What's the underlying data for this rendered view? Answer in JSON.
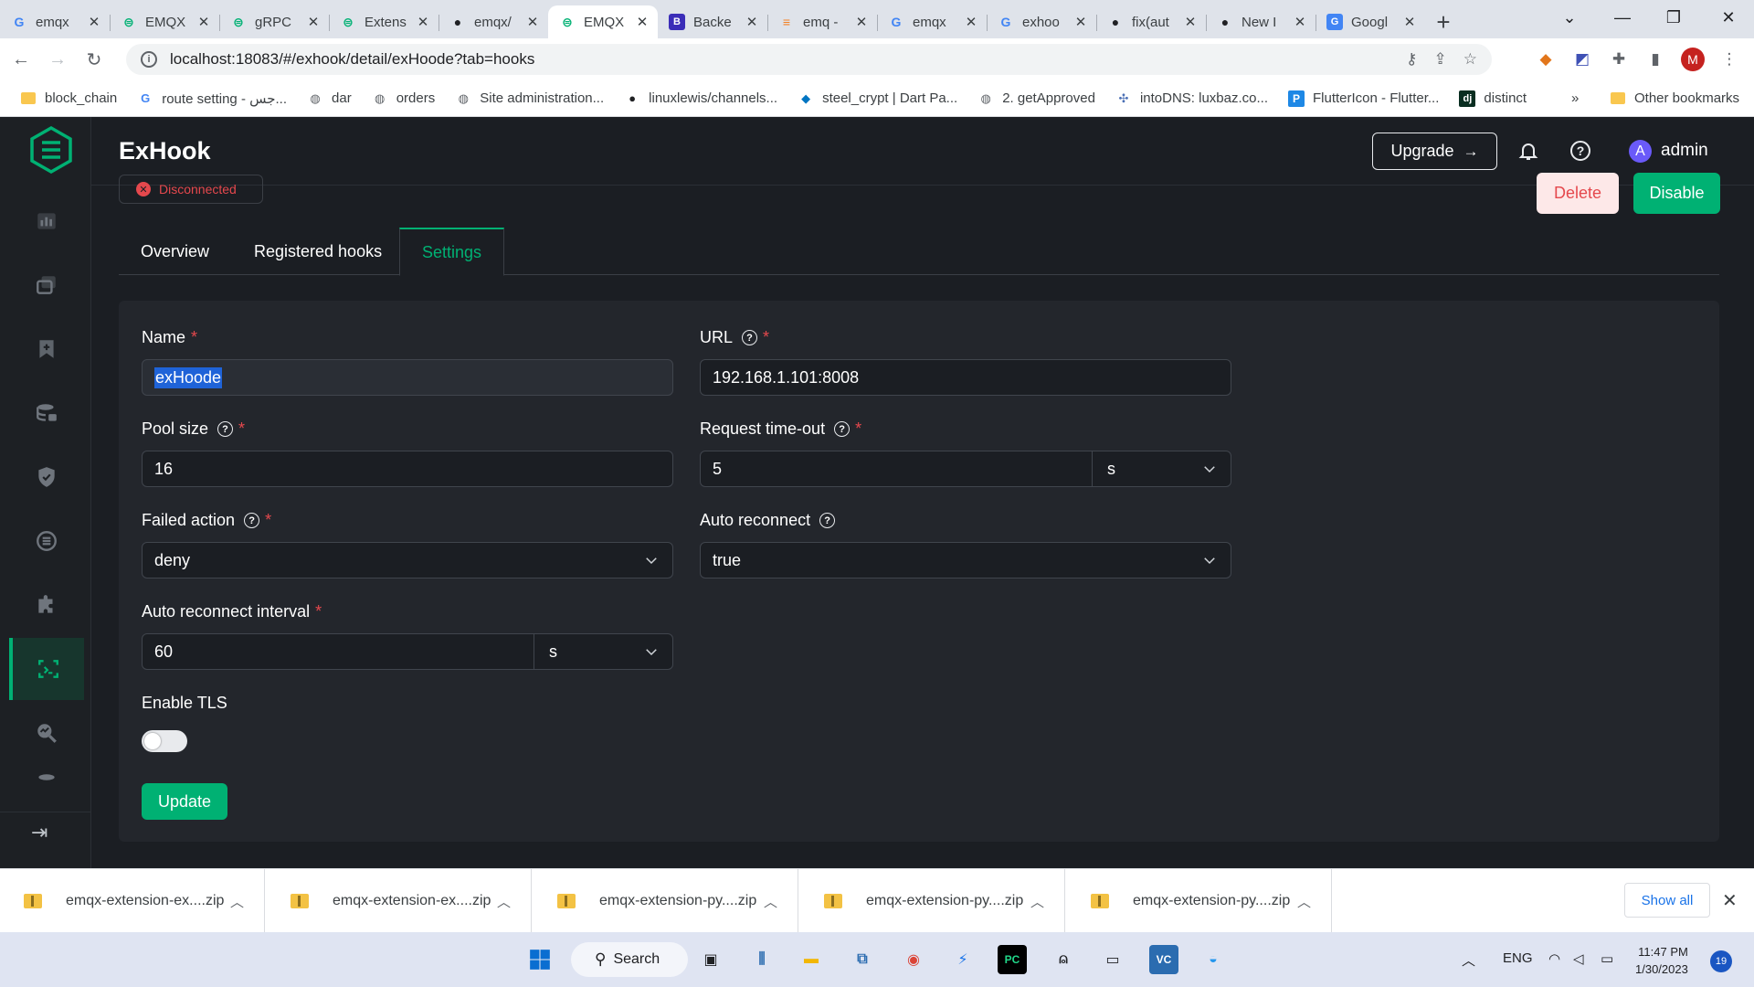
{
  "browser": {
    "tabs": [
      {
        "label": "emqx",
        "icon": "google-icon"
      },
      {
        "label": "EMQX",
        "icon": "emqx-icon"
      },
      {
        "label": "gRPC",
        "icon": "emqx-icon"
      },
      {
        "label": "Extens",
        "icon": "emqx-icon"
      },
      {
        "label": "emqx/",
        "icon": "github-icon"
      },
      {
        "label": "EMQX",
        "icon": "emqx-icon"
      },
      {
        "label": "Backe",
        "icon": "backend-icon"
      },
      {
        "label": "emq -",
        "icon": "stackoverflow-icon"
      },
      {
        "label": "emqx",
        "icon": "google-icon"
      },
      {
        "label": "exhoo",
        "icon": "google-icon"
      },
      {
        "label": "fix(aut",
        "icon": "github-icon"
      },
      {
        "label": "New I",
        "icon": "github-icon"
      },
      {
        "label": "Googl",
        "icon": "google-translate-icon"
      }
    ],
    "active_tab_index": 5,
    "url": "localhost:18083/#/exhook/detail/exHoode?tab=hooks",
    "profile_initial": "M",
    "bookmarks": [
      {
        "label": "block_chain",
        "icon": "folder-icon"
      },
      {
        "label": "route setting - جس...",
        "icon": "google-icon"
      },
      {
        "label": "dar",
        "icon": "globe-icon"
      },
      {
        "label": "orders",
        "icon": "globe-icon"
      },
      {
        "label": "Site administration...",
        "icon": "globe-icon"
      },
      {
        "label": "linuxlewis/channels...",
        "icon": "github-icon"
      },
      {
        "label": "steel_crypt | Dart Pa...",
        "icon": "dart-icon"
      },
      {
        "label": "2. getApproved",
        "icon": "globe-icon"
      },
      {
        "label": "intoDNS: luxbaz.co...",
        "icon": "dns-icon"
      },
      {
        "label": "FlutterIcon - Flutter...",
        "icon": "fluttericon-icon"
      },
      {
        "label": "distinct",
        "icon": "django-icon"
      }
    ],
    "bookmarks_more": "»",
    "other_bookmarks": "Other bookmarks"
  },
  "header": {
    "title": "ExHook",
    "upgrade_label": "Upgrade",
    "user_initial": "A",
    "user_name": "admin"
  },
  "detail": {
    "status": "Disconnected",
    "delete_label": "Delete",
    "disable_label": "Disable",
    "tabs": [
      "Overview",
      "Registered hooks",
      "Settings"
    ],
    "active_tab": "Settings"
  },
  "form": {
    "name": {
      "label": "Name",
      "value": "exHoode"
    },
    "url": {
      "label": "URL",
      "value": "192.168.1.101:8008"
    },
    "pool_size": {
      "label": "Pool size",
      "value": "16"
    },
    "request_timeout": {
      "label": "Request time-out",
      "value": "5",
      "unit": "s"
    },
    "failed_action": {
      "label": "Failed action",
      "value": "deny"
    },
    "auto_reconnect": {
      "label": "Auto reconnect",
      "value": "true"
    },
    "auto_reconnect_interval": {
      "label": "Auto reconnect interval",
      "value": "60",
      "unit": "s"
    },
    "enable_tls": {
      "label": "Enable TLS",
      "enabled": false
    },
    "required_mark": "*",
    "update_label": "Update"
  },
  "downloads": {
    "items": [
      "emqx-extension-ex....zip",
      "emqx-extension-ex....zip",
      "emqx-extension-py....zip",
      "emqx-extension-py....zip",
      "emqx-extension-py....zip"
    ],
    "show_all": "Show all"
  },
  "taskbar": {
    "search_label": "Search",
    "language": "ENG",
    "time": "11:47 PM",
    "date": "1/30/2023",
    "notifications": "19"
  },
  "colors": {
    "accent": "#00b173",
    "danger": "#e5484d",
    "app_bg": "#1b1e23",
    "card_bg": "#23262c"
  }
}
